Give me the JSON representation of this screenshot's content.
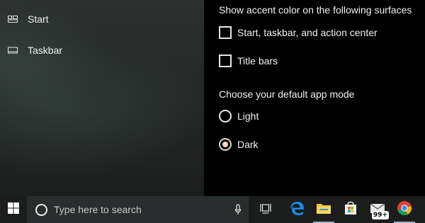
{
  "nav": {
    "items": [
      {
        "label": "Start",
        "icon": "start-layout-icon"
      },
      {
        "label": "Taskbar",
        "icon": "taskbar-icon"
      }
    ]
  },
  "content": {
    "accent_heading": "Show accent color on the following surfaces",
    "accent_options": [
      {
        "label": "Start, taskbar, and action center",
        "checked": false
      },
      {
        "label": "Title bars",
        "checked": false
      }
    ],
    "mode_heading": "Choose your default app mode",
    "mode_options": [
      {
        "label": "Light",
        "selected": false
      },
      {
        "label": "Dark",
        "selected": true
      }
    ]
  },
  "taskbar": {
    "search_placeholder": "Type here to search",
    "mail_badge": "99+",
    "icons": [
      "windows-logo-icon",
      "cortana-icon",
      "microphone-icon",
      "task-view-icon",
      "edge-icon",
      "file-explorer-icon",
      "store-icon",
      "mail-icon",
      "chrome-icon"
    ]
  },
  "colors": {
    "accent_radio_dot": "#f3d9c8",
    "taskbar": "#1b1d1d",
    "search_box": "#2a2d2d"
  }
}
